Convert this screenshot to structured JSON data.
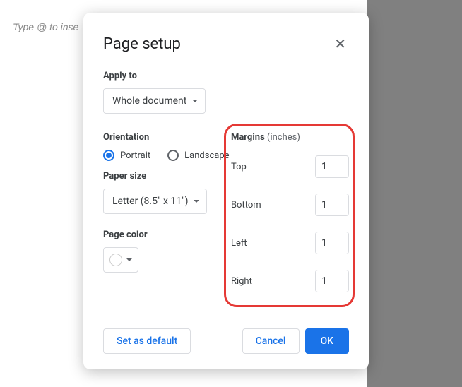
{
  "background": {
    "placeholder": "Type @ to inse"
  },
  "dialog": {
    "title": "Page setup",
    "apply_to": {
      "label": "Apply to",
      "value": "Whole document"
    },
    "orientation": {
      "label": "Orientation",
      "portrait": "Portrait",
      "landscape": "Landscape",
      "selected": "portrait"
    },
    "paper_size": {
      "label": "Paper size",
      "value": "Letter (8.5\" x 11\")"
    },
    "page_color": {
      "label": "Page color",
      "value": "#ffffff"
    },
    "margins": {
      "label": "Margins",
      "unit": "(inches)",
      "top": {
        "label": "Top",
        "value": "1"
      },
      "bottom": {
        "label": "Bottom",
        "value": "1"
      },
      "left": {
        "label": "Left",
        "value": "1"
      },
      "right": {
        "label": "Right",
        "value": "1"
      }
    },
    "actions": {
      "set_default": "Set as default",
      "cancel": "Cancel",
      "ok": "OK"
    }
  }
}
